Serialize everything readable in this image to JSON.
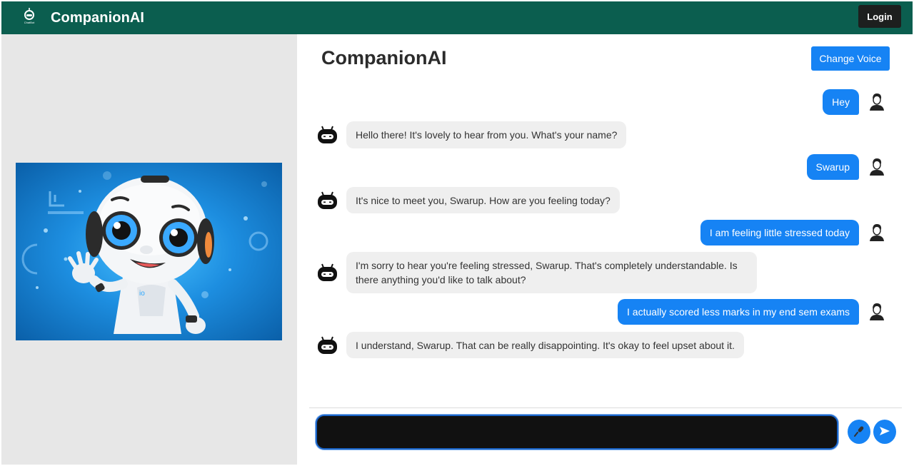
{
  "navbar": {
    "logo_caption": "ChatBot",
    "brand": "CompanionAI",
    "login_label": "Login"
  },
  "chat": {
    "title": "CompanionAI",
    "change_voice_label": "Change Voice",
    "messages": [
      {
        "sender": "user",
        "text": "Hey"
      },
      {
        "sender": "bot",
        "text": "Hello there! It's lovely to hear from you. What's your name?"
      },
      {
        "sender": "user",
        "text": "Swarup"
      },
      {
        "sender": "bot",
        "text": "It's nice to meet you, Swarup. How are you feeling today?"
      },
      {
        "sender": "user",
        "text": "I am feeling little stressed today"
      },
      {
        "sender": "bot",
        "text": "I'm sorry to hear you're feeling stressed, Swarup. That's completely understandable. Is there anything you'd like to talk about?"
      },
      {
        "sender": "user",
        "text": "I actually scored less marks in my end sem exams"
      },
      {
        "sender": "bot",
        "text": "I understand, Swarup. That can be really disappointing. It's okay to feel upset about it."
      }
    ],
    "input_value": "",
    "input_placeholder": ""
  },
  "icons": {
    "mic": "microphone-icon",
    "send": "send-arrow-icon",
    "user_avatar": "user-avatar-icon",
    "bot_avatar": "bot-avatar-icon"
  },
  "colors": {
    "navbar": "#0b5e4f",
    "accent": "#1683f4",
    "bot_bubble": "#efefef",
    "left_panel": "#e7e7e7"
  }
}
